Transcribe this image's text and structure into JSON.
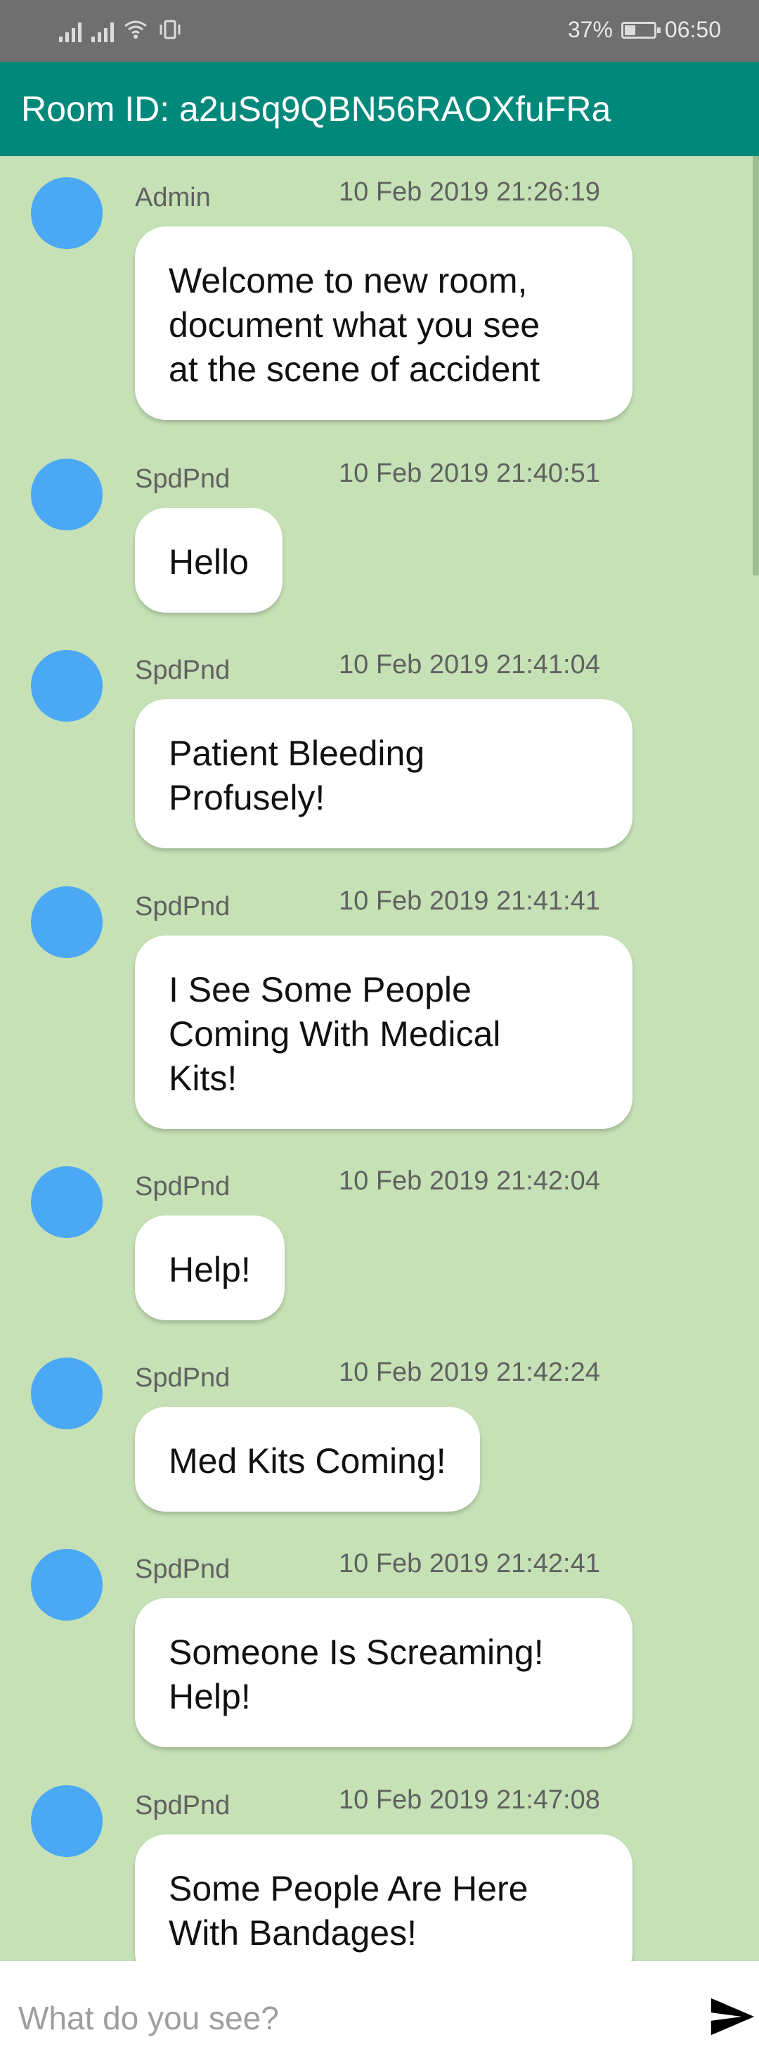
{
  "status": {
    "battery_percent": "37%",
    "battery_level": 0.37,
    "time": "06:50"
  },
  "header": {
    "title": "Room ID: a2uSq9QBN56RAOXfuFRa"
  },
  "messages": [
    {
      "sender": "Admin",
      "time": "10 Feb 2019 21:26:19",
      "lines": [
        "Welcome to new room,",
        "document what you see",
        "at the scene of accident"
      ]
    },
    {
      "sender": "SpdPnd",
      "time": "10 Feb 2019 21:40:51",
      "lines": [
        "Hello"
      ]
    },
    {
      "sender": "SpdPnd",
      "time": "10 Feb 2019 21:41:04",
      "lines": [
        "Patient Bleeding",
        "Profusely!"
      ]
    },
    {
      "sender": "SpdPnd",
      "time": "10 Feb 2019 21:41:41",
      "lines": [
        "I See Some People",
        "Coming With Medical",
        "Kits!"
      ]
    },
    {
      "sender": "SpdPnd",
      "time": "10 Feb 2019 21:42:04",
      "lines": [
        "Help!"
      ]
    },
    {
      "sender": "SpdPnd",
      "time": "10 Feb 2019 21:42:24",
      "lines": [
        "Med Kits Coming!"
      ]
    },
    {
      "sender": "SpdPnd",
      "time": "10 Feb 2019 21:42:41",
      "lines": [
        "Someone Is Screaming!",
        "Help!"
      ]
    },
    {
      "sender": "SpdPnd",
      "time": "10 Feb 2019 21:47:08",
      "lines": [
        "Some People Are Here",
        "With Bandages!"
      ]
    }
  ],
  "composer": {
    "placeholder": "What do you see?",
    "send_icon": "send-icon"
  },
  "colors": {
    "toolbar": "#00897b",
    "chat_background": "#c5e1b5",
    "avatar": "#4aa8f5",
    "status_bar": "#6f6f6f"
  }
}
